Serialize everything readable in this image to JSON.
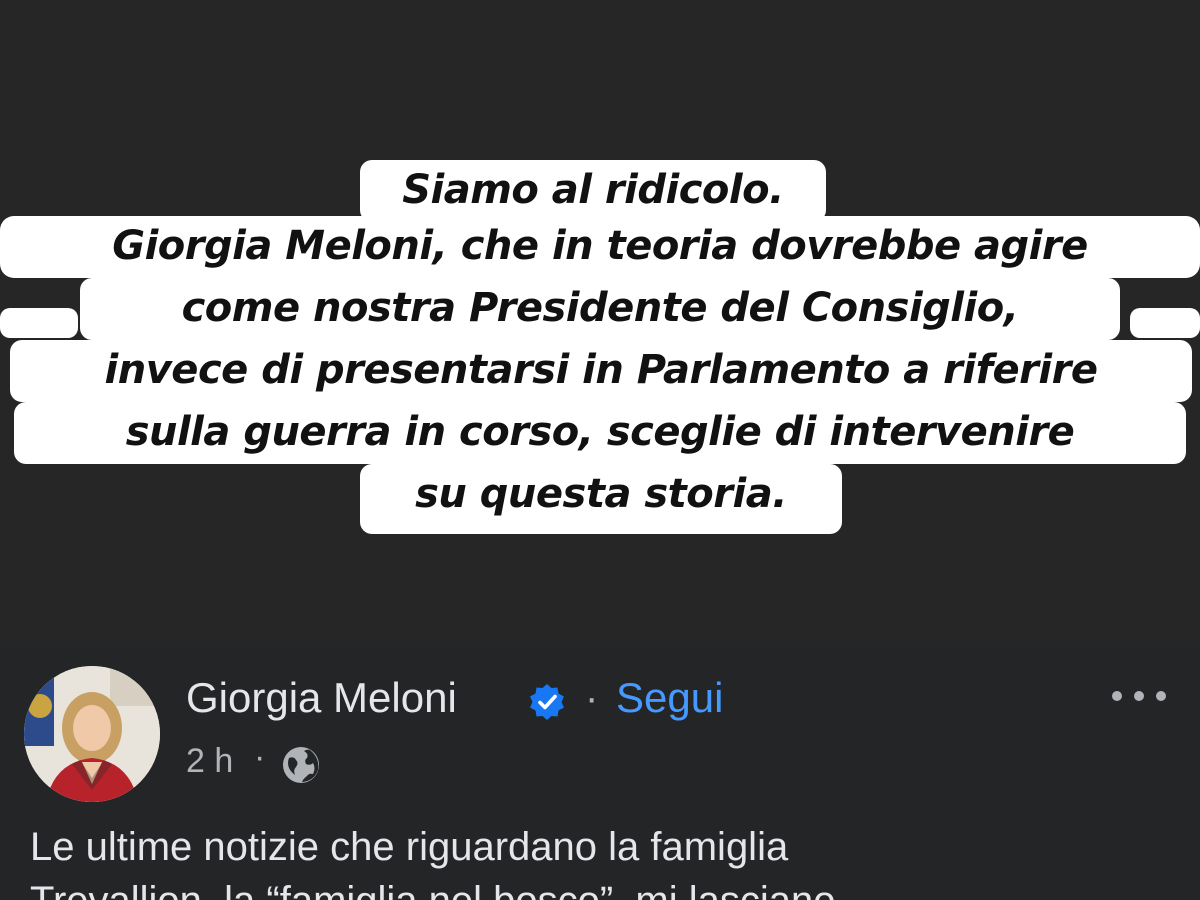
{
  "story": {
    "lines": [
      "Siamo al ridicolo.",
      "Giorgia Meloni, che in teoria dovrebbe agire",
      "come nostra Presidente del Consiglio,",
      "invece di presentarsi in Parlamento a riferire",
      "sulla guerra in corso, sceglie di intervenire",
      "su questa storia."
    ]
  },
  "post": {
    "author": "Giorgia Meloni",
    "separator": "·",
    "follow_label": "Segui",
    "time": "2 h",
    "audience_icon": "globe-icon",
    "verified_icon": "verified-badge-icon",
    "more_icon": "more-options-icon",
    "body_lines": [
      "Le ultime notizie che riguardano la famiglia",
      "Trevallion, la “famiglia nel bosco”, mi lasciano"
    ]
  },
  "colors": {
    "background": "#262627",
    "post_background": "#242526",
    "caption_background": "#ffffff",
    "text_primary": "#e4e6eb",
    "text_secondary": "#b0b3b8",
    "link": "#4599ff",
    "verified": "#1877f2"
  }
}
